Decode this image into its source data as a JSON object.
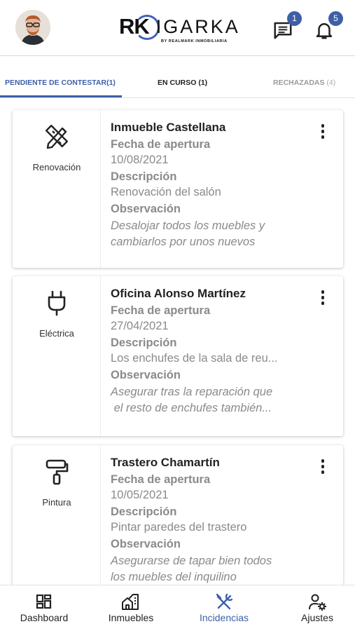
{
  "header": {
    "logo_main": "IGARKA",
    "logo_rk": "RK",
    "logo_sub": "BY REALMARK INMOBILIARIA",
    "messages_badge": "1",
    "notifications_badge": "5"
  },
  "tabs": [
    {
      "label": "PENDIENTE DE CONTESTAR(1)",
      "active": true
    },
    {
      "label": "EN CURSO (1)",
      "active": false
    },
    {
      "label": "RECHAZADAS",
      "count": "(4)",
      "active": false
    }
  ],
  "field_labels": {
    "date": "Fecha de apertura",
    "description": "Descripción",
    "observation": "Observación"
  },
  "cards": [
    {
      "category": "Renovación",
      "icon": "ruler-pencil-icon",
      "title": "Inmueble Castellana",
      "date": "10/08/2021",
      "description": "Renovación del salón",
      "observation_1": "Desalojar todos los muebles y",
      "observation_2": "cambiarlos por unos nuevos"
    },
    {
      "category": "Eléctrica",
      "icon": "plug-icon",
      "title": "Oficina Alonso Martínez",
      "date": "27/04/2021",
      "description": "Los enchufes de la sala de reu...",
      "observation_1": "Asegurar tras la reparación que",
      "observation_2": " el resto de enchufes también..."
    },
    {
      "category": "Pintura",
      "icon": "paint-roller-icon",
      "title": "Trastero Chamartín",
      "date": "10/05/2021",
      "description": "Pintar paredes del trastero",
      "observation_1": "Asegurarse de tapar bien todos",
      "observation_2": "los muebles del inquilino"
    }
  ],
  "bottom_nav": [
    {
      "label": "Dashboard",
      "icon": "dashboard-icon",
      "active": false
    },
    {
      "label": "Inmuebles",
      "icon": "building-icon",
      "active": false
    },
    {
      "label": "Incidencias",
      "icon": "tools-icon",
      "active": true
    },
    {
      "label": "Ajustes",
      "icon": "user-settings-icon",
      "active": false
    }
  ],
  "colors": {
    "accent": "#3e5fa8",
    "label_gray": "#8a8a8a"
  }
}
